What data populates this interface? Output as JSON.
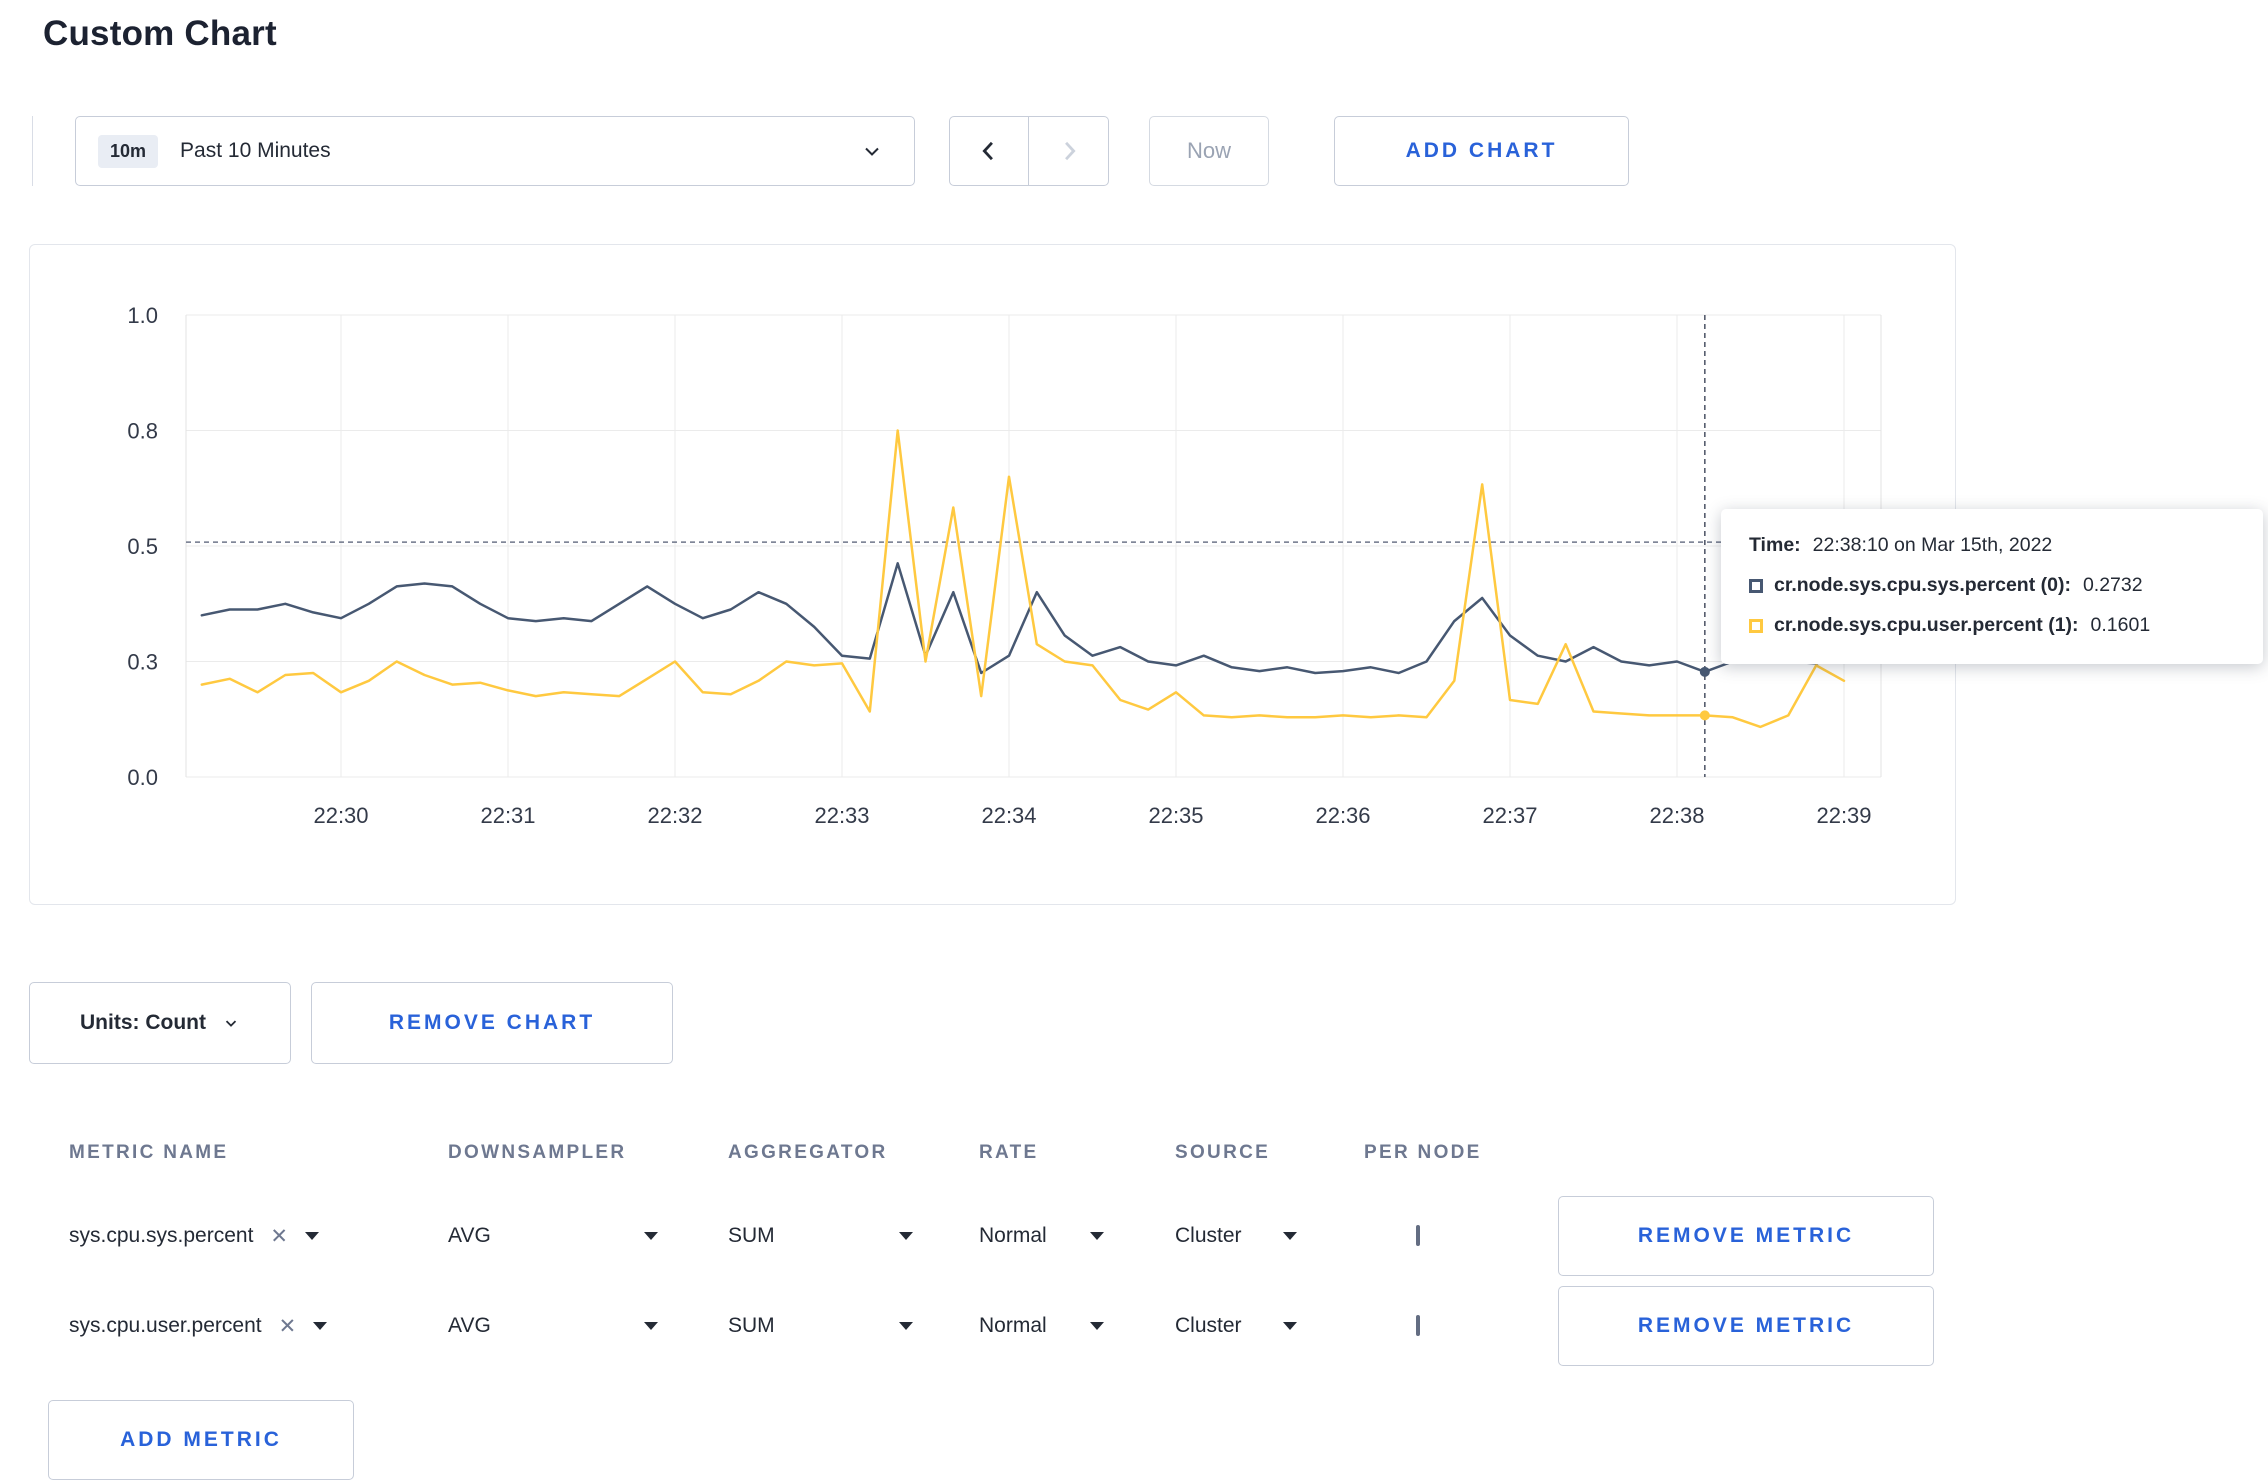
{
  "page": {
    "title": "Custom Chart"
  },
  "colors": {
    "accent_blue": "#2962d9",
    "series_sys": "#475872",
    "series_user": "#ffc940",
    "grid": "#ebebeb"
  },
  "toolbar": {
    "range_badge": "10m",
    "range_label": "Past 10 Minutes",
    "now_label": "Now",
    "add_chart_label": "ADD CHART"
  },
  "chart_controls": {
    "units_label": "Units: Count",
    "remove_chart_label": "REMOVE CHART"
  },
  "tooltip": {
    "time_label": "Time:",
    "time_value": "22:38:10 on Mar 15th, 2022",
    "series": [
      {
        "label": "cr.node.sys.cpu.sys.percent (0):",
        "value": "0.2732"
      },
      {
        "label": "cr.node.sys.cpu.user.percent (1):",
        "value": "0.1601"
      }
    ]
  },
  "chart_data": {
    "type": "line",
    "title": "",
    "x_tick_labels": [
      "22:30",
      "22:31",
      "22:32",
      "22:33",
      "22:34",
      "22:35",
      "22:36",
      "22:37",
      "22:38",
      "22:39"
    ],
    "y_tick_labels": [
      "0.0",
      "0.3",
      "0.5",
      "0.8",
      "1.0"
    ],
    "y_ticks": [
      0,
      0.3,
      0.5,
      0.8,
      1.0
    ],
    "start_time": "22:29:10",
    "interval_seconds": 10,
    "legend_position": "tooltip",
    "grid": true,
    "series": [
      {
        "name": "cr.node.sys.cpu.sys.percent",
        "color": "#475872",
        "values": [
          0.38,
          0.39,
          0.39,
          0.4,
          0.385,
          0.375,
          0.4,
          0.43,
          0.435,
          0.43,
          0.4,
          0.375,
          0.37,
          0.375,
          0.37,
          0.4,
          0.43,
          0.4,
          0.375,
          0.39,
          0.42,
          0.4,
          0.36,
          0.31,
          0.305,
          0.47,
          0.31,
          0.42,
          0.27,
          0.31,
          0.42,
          0.345,
          0.31,
          0.325,
          0.3,
          0.29,
          0.31,
          0.285,
          0.275,
          0.285,
          0.27,
          0.275,
          0.285,
          0.27,
          0.3,
          0.37,
          0.41,
          0.345,
          0.31,
          0.3,
          0.325,
          0.3,
          0.29,
          0.3,
          0.2732,
          0.3,
          0.32,
          0.3,
          0.295,
          0.31
        ]
      },
      {
        "name": "cr.node.sys.cpu.user.percent",
        "color": "#ffc940",
        "values": [
          0.24,
          0.255,
          0.22,
          0.265,
          0.27,
          0.22,
          0.25,
          0.3,
          0.265,
          0.24,
          0.245,
          0.225,
          0.21,
          0.22,
          0.215,
          0.21,
          0.255,
          0.3,
          0.22,
          0.215,
          0.25,
          0.3,
          0.29,
          0.295,
          0.17,
          0.8,
          0.3,
          0.6,
          0.21,
          0.68,
          0.33,
          0.3,
          0.29,
          0.2,
          0.175,
          0.22,
          0.16,
          0.155,
          0.16,
          0.155,
          0.155,
          0.16,
          0.155,
          0.16,
          0.155,
          0.25,
          0.66,
          0.2,
          0.19,
          0.33,
          0.17,
          0.165,
          0.16,
          0.16,
          0.1601,
          0.155,
          0.13,
          0.16,
          0.29,
          0.25
        ]
      }
    ],
    "crosshair": {
      "time": "22:38:10",
      "offset_seconds": 540,
      "index": 54,
      "hover_value": 0.51
    }
  },
  "metrics_table": {
    "headers": [
      "METRIC NAME",
      "DOWNSAMPLER",
      "AGGREGATOR",
      "RATE",
      "SOURCE",
      "PER NODE"
    ],
    "rows": [
      {
        "metric": "sys.cpu.sys.percent",
        "downsampler": "AVG",
        "aggregator": "SUM",
        "rate": "Normal",
        "source": "Cluster",
        "per_node_checked": false,
        "remove_label": "REMOVE METRIC"
      },
      {
        "metric": "sys.cpu.user.percent",
        "downsampler": "AVG",
        "aggregator": "SUM",
        "rate": "Normal",
        "source": "Cluster",
        "per_node_checked": false,
        "remove_label": "REMOVE METRIC"
      }
    ],
    "add_metric_label": "ADD METRIC"
  },
  "icons": {
    "clear": "✕"
  }
}
